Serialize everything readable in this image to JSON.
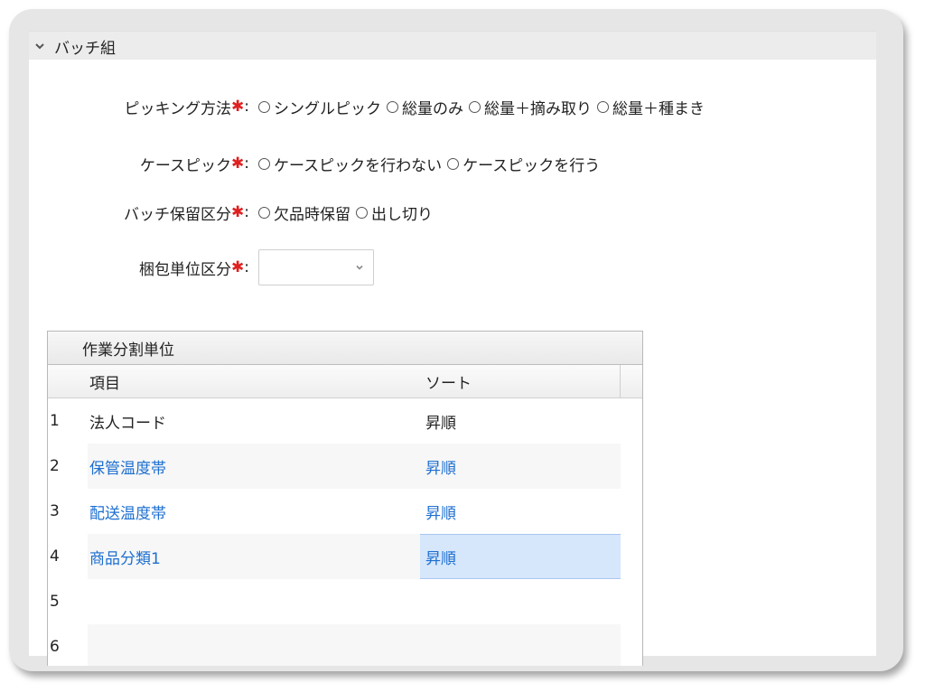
{
  "section": {
    "title": "バッチ組"
  },
  "form": {
    "picking": {
      "label": "ピッキング方法",
      "options": [
        "シングルピック",
        "総量のみ",
        "総量＋摘み取り",
        "総量＋種まき"
      ]
    },
    "case_pick": {
      "label": "ケースピック",
      "options": [
        "ケースピックを行わない",
        "ケースピックを行う"
      ]
    },
    "batch_hold": {
      "label": "バッチ保留区分",
      "options": [
        "欠品時保留",
        "出し切り"
      ]
    },
    "packing": {
      "label": "梱包単位区分",
      "value": ""
    },
    "required_mark": "✱",
    "colon": ":"
  },
  "grid": {
    "title": "作業分割単位",
    "columns": {
      "item": "項目",
      "sort": "ソート"
    },
    "rows": [
      {
        "num": "1",
        "item": "法人コード",
        "sort": "昇順"
      },
      {
        "num": "2",
        "item": "保管温度帯",
        "sort": "昇順"
      },
      {
        "num": "3",
        "item": "配送温度帯",
        "sort": "昇順"
      },
      {
        "num": "4",
        "item": "商品分類1",
        "sort": "昇順"
      },
      {
        "num": "5",
        "item": "",
        "sort": ""
      },
      {
        "num": "6",
        "item": "",
        "sort": ""
      }
    ]
  },
  "colors": {
    "link": "#1d6fd0",
    "required": "#e02020",
    "selected_cell": "#d6e6fb"
  }
}
